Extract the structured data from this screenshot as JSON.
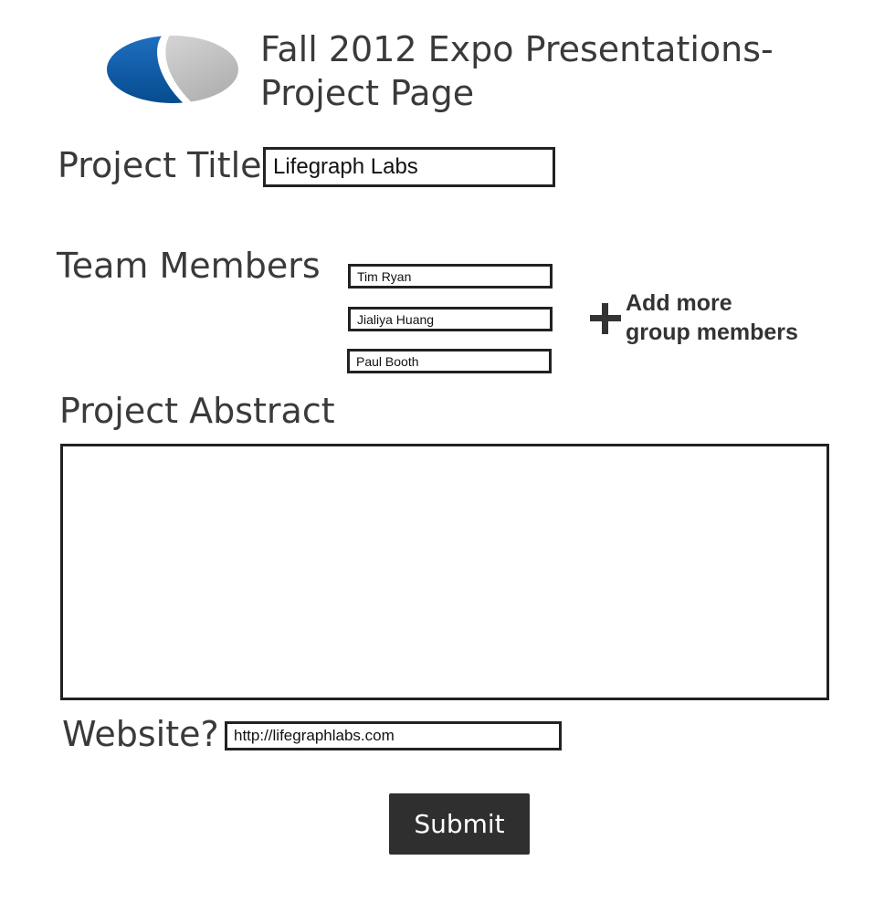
{
  "header": {
    "logo_icon": "split-oval-logo-icon",
    "title_line1": "Fall 2012 Expo Presentations-",
    "title_line2": "Project Page"
  },
  "project_title": {
    "label": "Project Title",
    "value": "Lifegraph Labs"
  },
  "team": {
    "label": "Team Members",
    "members": [
      "Tim Ryan",
      "Jialiya Huang",
      "Paul Booth"
    ],
    "add_icon": "plus-icon",
    "add_line1": "Add more",
    "add_line2": "group members"
  },
  "abstract": {
    "label": "Project Abstract",
    "value": ""
  },
  "website": {
    "label": "Website?",
    "value": "http://lifegraphlabs.com"
  },
  "submit_label": "Submit",
  "colors": {
    "logo_blue": "#0b5aa6",
    "logo_gray": "#c4c4c4",
    "button_bg": "#2f2f2f",
    "text": "#3a3a3a"
  }
}
